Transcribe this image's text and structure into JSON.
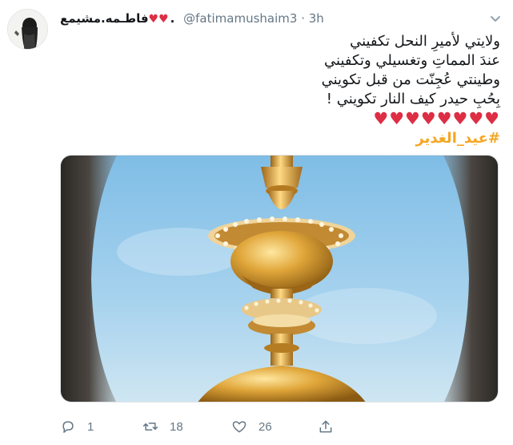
{
  "tweet": {
    "display_name": "فاطـمه.مشيمع",
    "display_name_hearts": "♥♥",
    "display_name_suffix": ".",
    "handle": "@fatimamushaim3",
    "separator": "·",
    "timestamp": "3h",
    "lines": [
      "ولايتي لأميرِ النحل تكفيني",
      "عندَ المماتِ وتغسيلي وتكفيني",
      "وطينتي عُجِنّت من قبل تكويني",
      "بِحُبِ حيدر كيف النار تكويني !"
    ],
    "hearts_row": "♥♥♥♥♥♥♥♥",
    "hashtag": "#عيد_الغدير"
  },
  "actions": {
    "reply_count": "1",
    "retweet_count": "18",
    "like_count": "26"
  },
  "colors": {
    "accent_hashtag": "#f5a623",
    "heart": "#dd2e44",
    "muted": "#657786"
  },
  "icons": [
    "caret-down-icon",
    "reply-icon",
    "retweet-icon",
    "like-icon",
    "share-icon"
  ]
}
